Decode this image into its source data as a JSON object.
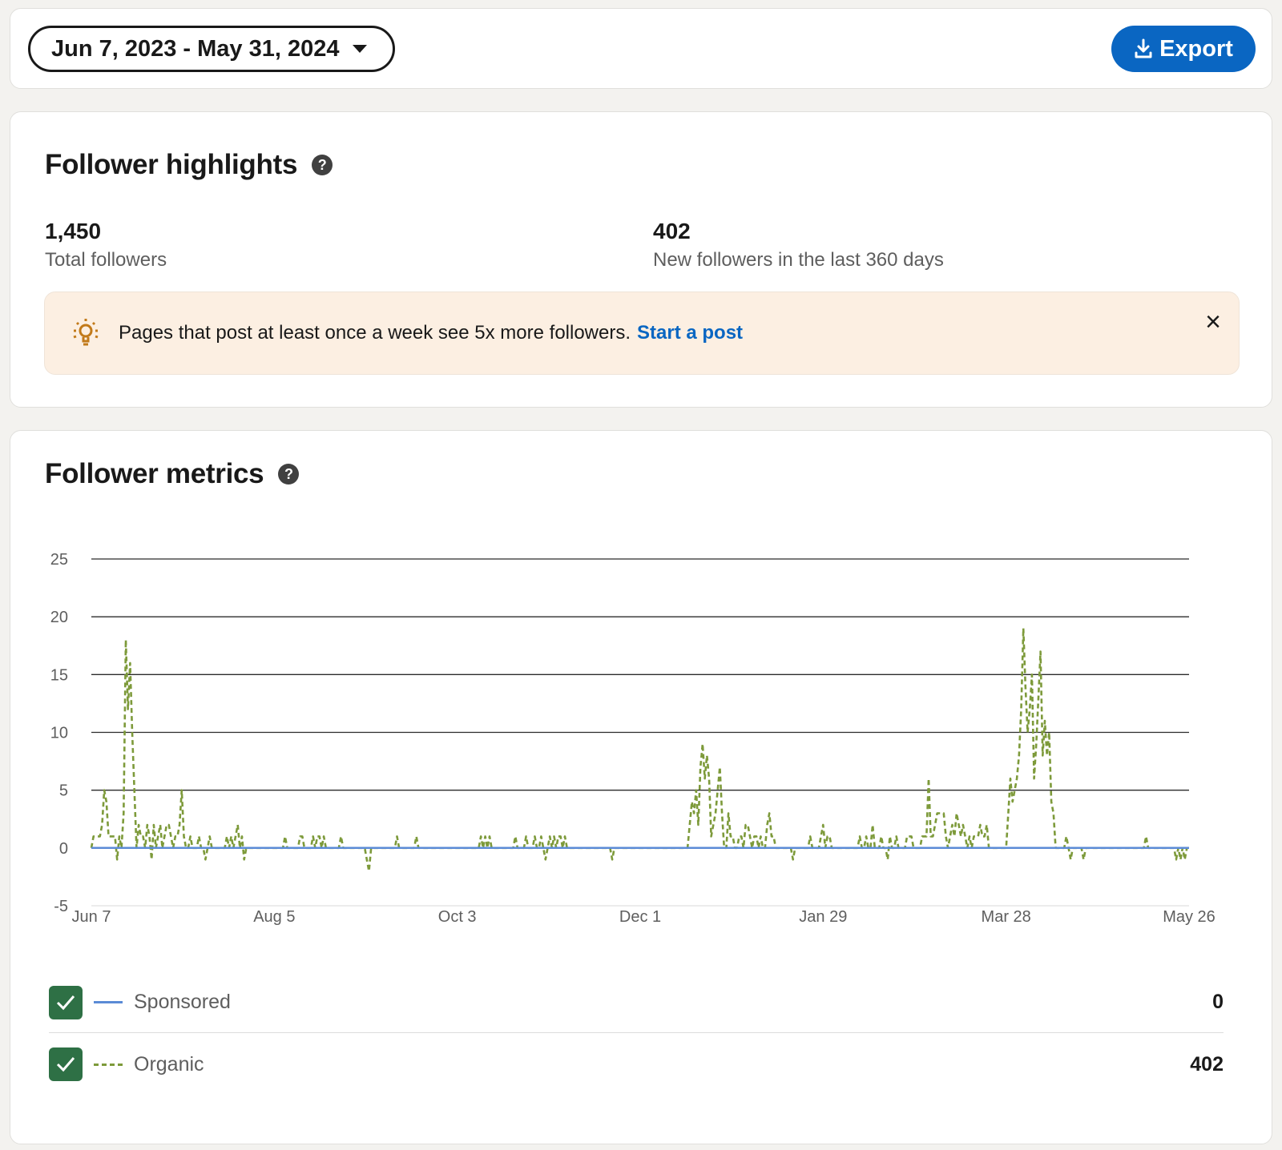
{
  "toolbar": {
    "date_range": "Jun 7, 2023 - May 31, 2024",
    "export_label": "Export"
  },
  "highlights": {
    "title": "Follower highlights",
    "total_followers": "1,450",
    "total_label": "Total followers",
    "new_followers": "402",
    "new_label": "New followers in the last 360 days",
    "tip_text": "Pages that post at least once a week see 5x more followers.",
    "tip_link": "Start a post",
    "close_icon": "×"
  },
  "metrics": {
    "title": "Follower metrics",
    "legend": [
      {
        "label": "Sponsored",
        "value": "0",
        "color": "#5b8bd6",
        "style": "solid"
      },
      {
        "label": "Organic",
        "value": "402",
        "color": "#7d9a3a",
        "style": "dashed"
      }
    ]
  },
  "colors": {
    "accent": "#0a66c2",
    "check": "#2e7045",
    "organic": "#7d9a3a",
    "sponsored": "#5b8bd6",
    "tip_bg": "#fcefe2"
  },
  "chart_data": {
    "type": "line",
    "ylim": [
      -5,
      25
    ],
    "yticks": [
      25,
      20,
      15,
      10,
      5,
      0,
      -5
    ],
    "xticks": [
      "Jun 7",
      "Aug 5",
      "Oct 3",
      "Dec 1",
      "Jan 29",
      "Mar 28",
      "May 26"
    ],
    "x_start": "2023-06-07",
    "x_end": "2024-05-31",
    "grid": true,
    "series": [
      {
        "name": "Sponsored",
        "values": [
          0,
          0,
          0,
          0,
          0,
          0,
          0,
          0,
          0,
          0,
          0,
          0,
          0,
          0,
          0,
          0,
          0,
          0,
          0,
          0,
          0,
          0,
          0,
          0,
          0,
          0,
          0,
          0,
          0,
          0,
          0,
          0,
          0,
          0,
          0,
          0,
          0,
          0,
          0,
          0,
          0,
          0,
          0,
          0,
          0,
          0,
          0,
          0,
          0,
          0,
          0,
          0,
          0,
          0,
          0,
          0,
          0,
          0,
          0,
          0,
          0,
          0,
          0,
          0,
          0,
          0,
          0,
          0,
          0,
          0,
          0,
          0,
          0,
          0,
          0,
          0,
          0,
          0,
          0,
          0,
          0,
          0,
          0,
          0,
          0,
          0,
          0,
          0,
          0,
          0,
          0,
          0,
          0,
          0,
          0,
          0,
          0,
          0,
          0,
          0,
          0,
          0,
          0,
          0,
          0,
          0,
          0,
          0,
          0,
          0,
          0,
          0,
          0,
          0,
          0,
          0,
          0,
          0,
          0,
          0,
          0,
          0,
          0,
          0,
          0,
          0,
          0,
          0,
          0,
          0,
          0,
          0,
          0,
          0,
          0,
          0,
          0,
          0,
          0,
          0,
          0,
          0,
          0,
          0,
          0,
          0,
          0,
          0,
          0,
          0,
          0,
          0,
          0,
          0,
          0,
          0,
          0,
          0,
          0,
          0,
          0,
          0,
          0,
          0,
          0,
          0,
          0,
          0,
          0,
          0,
          0,
          0,
          0,
          0,
          0,
          0,
          0,
          0,
          0,
          0,
          0,
          0,
          0,
          0,
          0,
          0,
          0,
          0,
          0,
          0,
          0,
          0,
          0,
          0,
          0,
          0,
          0,
          0,
          0,
          0,
          0,
          0,
          0,
          0,
          0,
          0,
          0,
          0,
          0,
          0,
          0,
          0,
          0,
          0,
          0,
          0,
          0,
          0,
          0,
          0,
          0,
          0,
          0,
          0,
          0,
          0,
          0,
          0,
          0,
          0,
          0,
          0,
          0,
          0,
          0,
          0,
          0,
          0,
          0,
          0,
          0,
          0,
          0,
          0,
          0,
          0,
          0,
          0,
          0,
          0,
          0,
          0,
          0,
          0,
          0,
          0,
          0,
          0,
          0,
          0,
          0,
          0,
          0,
          0,
          0,
          0,
          0,
          0,
          0,
          0,
          0,
          0,
          0,
          0,
          0,
          0,
          0,
          0,
          0,
          0,
          0,
          0,
          0,
          0,
          0,
          0,
          0,
          0,
          0,
          0,
          0,
          0,
          0,
          0,
          0,
          0,
          0,
          0,
          0,
          0,
          0,
          0,
          0,
          0,
          0,
          0,
          0,
          0,
          0,
          0,
          0,
          0,
          0,
          0,
          0,
          0,
          0,
          0,
          0,
          0,
          0,
          0,
          0,
          0,
          0,
          0,
          0,
          0,
          0,
          0,
          0,
          0,
          0,
          0,
          0,
          0,
          0,
          0,
          0,
          0,
          0,
          0,
          0,
          0,
          0,
          0,
          0,
          0,
          0,
          0,
          0,
          0,
          0,
          0,
          0,
          0,
          0,
          0,
          0,
          0,
          0,
          0,
          0,
          0,
          0,
          0,
          0,
          0,
          0,
          0,
          0,
          0,
          0,
          0,
          0,
          0,
          0,
          0,
          0,
          0,
          0,
          0,
          0,
          0
        ]
      },
      {
        "name": "Organic",
        "values": [
          0,
          1,
          1,
          1,
          1,
          2,
          5,
          4,
          1,
          1,
          1,
          1,
          -1,
          1,
          0,
          3,
          18,
          12,
          16,
          10,
          5,
          0,
          2,
          1,
          1,
          0,
          2,
          1,
          -1,
          2,
          0,
          1,
          2,
          0,
          1,
          2,
          2,
          1,
          0,
          1,
          1,
          2,
          5,
          1,
          0,
          0,
          1,
          0,
          0,
          0,
          1,
          0,
          0,
          -1,
          0,
          1,
          0,
          0,
          0,
          0,
          0,
          0,
          0,
          1,
          0,
          1,
          0,
          1,
          2,
          0,
          1,
          -1,
          0,
          0,
          0,
          0,
          0,
          0,
          0,
          0,
          0,
          0,
          0,
          0,
          0,
          0,
          0,
          0,
          0,
          0,
          1,
          0,
          0,
          0,
          0,
          0,
          0,
          1,
          1,
          0,
          0,
          0,
          0,
          1,
          0,
          1,
          1,
          0,
          1,
          0,
          0,
          0,
          0,
          0,
          0,
          0,
          1,
          0,
          0,
          0,
          0,
          0,
          0,
          0,
          0,
          0,
          0,
          0,
          -1,
          -2,
          0,
          0,
          0,
          0,
          0,
          0,
          0,
          0,
          0,
          0,
          0,
          0,
          1,
          0,
          0,
          0,
          0,
          0,
          0,
          0,
          0,
          1,
          0,
          0,
          0,
          0,
          0,
          0,
          0,
          0,
          0,
          0,
          0,
          0,
          0,
          0,
          0,
          0,
          0,
          0,
          0,
          0,
          0,
          0,
          0,
          0,
          0,
          0,
          0,
          0,
          0,
          1,
          0,
          1,
          0,
          1,
          0,
          0,
          0,
          0,
          0,
          0,
          0,
          0,
          0,
          0,
          0,
          1,
          0,
          0,
          0,
          0,
          1,
          0,
          0,
          0,
          1,
          0,
          0,
          1,
          0,
          -1,
          0,
          1,
          0,
          1,
          0,
          1,
          1,
          0,
          1,
          0,
          0,
          0,
          0,
          0,
          0,
          0,
          0,
          0,
          0,
          0,
          0,
          0,
          0,
          0,
          0,
          0,
          0,
          0,
          0,
          0,
          -1,
          0,
          0,
          0,
          0,
          0,
          0,
          0,
          0,
          0,
          0,
          0,
          0,
          0,
          0,
          0,
          0,
          0,
          0,
          0,
          0,
          0,
          0,
          0,
          0,
          0,
          0,
          0,
          0,
          0,
          0,
          0,
          0,
          0,
          0,
          0,
          2,
          4,
          3,
          5,
          2,
          7,
          9,
          6,
          8,
          6,
          1,
          2,
          3,
          5,
          7,
          3,
          0,
          0,
          3,
          1,
          1,
          0,
          0,
          1,
          1,
          0,
          2,
          2,
          1,
          0,
          1,
          1,
          0,
          1,
          0,
          0,
          2,
          3,
          1,
          1,
          0,
          0,
          0,
          0,
          0,
          0,
          0,
          0,
          -1,
          0,
          0,
          0,
          0,
          0,
          0,
          0,
          1,
          0,
          0,
          0,
          0,
          1,
          2,
          0,
          1,
          1,
          0,
          0,
          0,
          0,
          0,
          0,
          0,
          0,
          0,
          0,
          0,
          0,
          0,
          1,
          0,
          0,
          1,
          0,
          0,
          2,
          0,
          0,
          0,
          1,
          0,
          0,
          -1,
          1,
          0,
          0,
          1,
          0,
          0,
          0,
          0,
          1,
          1,
          1,
          0,
          0,
          0,
          0,
          1,
          1,
          1,
          6,
          1,
          1,
          2,
          3,
          3,
          3,
          3,
          1,
          0,
          1,
          2,
          1,
          3,
          2,
          1,
          2,
          1,
          0,
          1,
          0,
          1,
          1,
          1,
          2,
          1,
          1,
          2,
          0,
          0,
          0,
          0,
          0,
          0,
          0,
          0,
          0,
          3,
          6,
          4,
          5,
          6,
          8,
          12,
          19,
          14,
          10,
          12,
          15,
          6,
          9,
          13,
          17,
          8,
          11,
          8,
          10,
          4,
          3,
          0,
          0,
          0,
          0,
          0,
          1,
          0,
          -1,
          0,
          0,
          0,
          0,
          0,
          -1,
          0,
          0,
          0,
          0,
          0,
          0,
          0,
          0,
          0,
          0,
          0,
          0,
          0,
          0,
          0,
          0,
          0,
          0,
          0,
          0,
          0,
          0,
          0,
          0,
          0,
          0,
          0,
          0,
          1,
          0,
          0,
          0,
          0,
          0,
          0,
          0,
          0,
          0,
          0,
          0,
          0,
          0,
          -1,
          0,
          -1,
          0,
          -1,
          0,
          0
        ]
      }
    ]
  }
}
